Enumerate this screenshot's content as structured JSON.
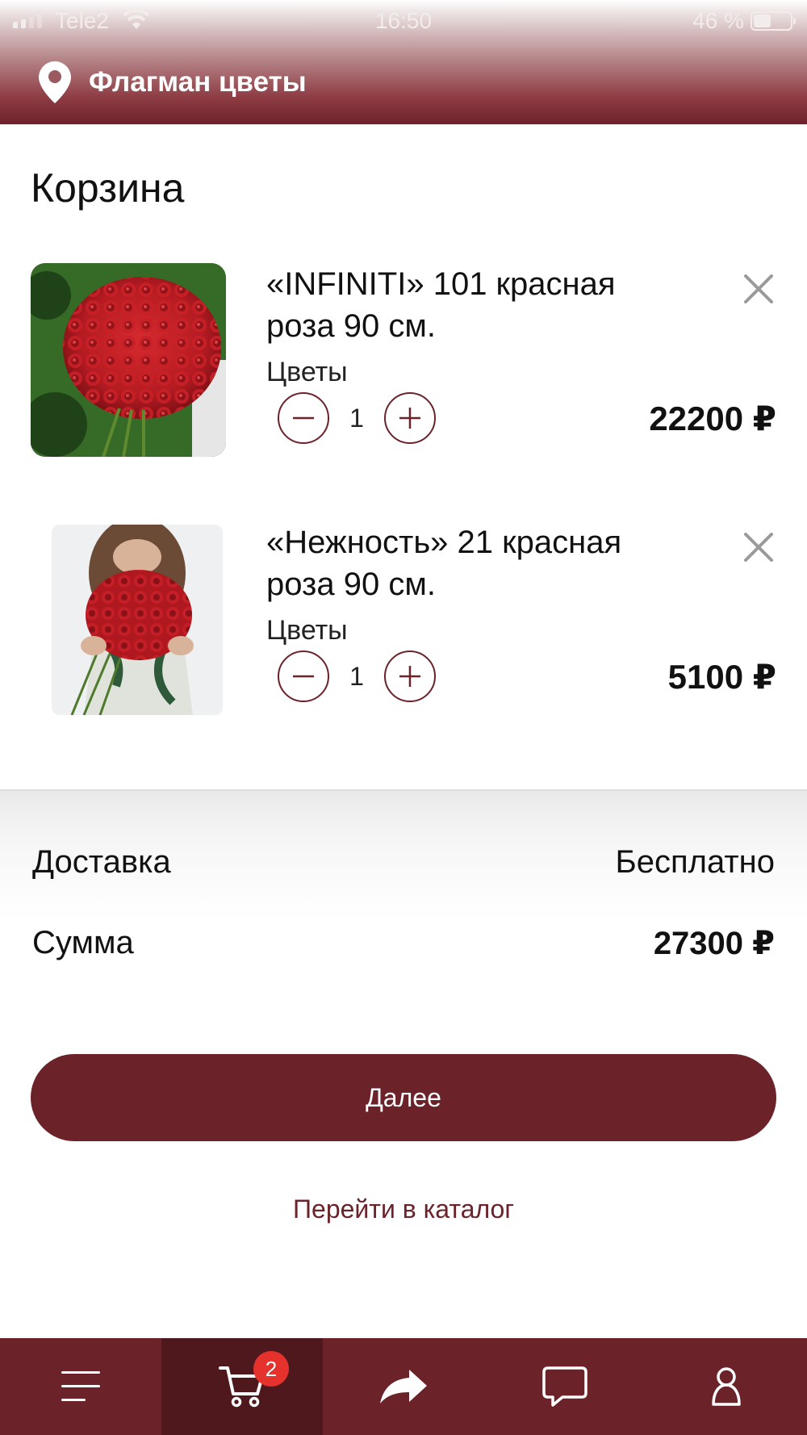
{
  "status_bar": {
    "carrier": "Tele2",
    "time": "16:50",
    "battery": "46 %"
  },
  "header": {
    "store_name": "Флагман цветы"
  },
  "page": {
    "title": "Корзина"
  },
  "cart": {
    "items": [
      {
        "title": "«INFINITI» 101 красная роза 90 см.",
        "category": "Цветы",
        "quantity": "1",
        "price": "22200 ₽"
      },
      {
        "title": "«Нежность» 21 красная роза 90 см.",
        "category": "Цветы",
        "quantity": "1",
        "price": "5100 ₽"
      }
    ]
  },
  "summary": {
    "delivery_label": "Доставка",
    "delivery_value": "Бесплатно",
    "total_label": "Сумма",
    "total_value": "27300 ₽"
  },
  "actions": {
    "next_label": "Далее",
    "catalog_link": "Перейти в каталог"
  },
  "tabbar": {
    "tabs": [
      {
        "icon": "menu-icon"
      },
      {
        "icon": "cart-icon",
        "badge": "2",
        "active": true
      },
      {
        "icon": "share-icon"
      },
      {
        "icon": "chat-icon"
      },
      {
        "icon": "profile-icon"
      }
    ]
  },
  "colors": {
    "brand": "#6b2228",
    "brand_dark": "#4e181d",
    "badge": "#e5322d"
  }
}
